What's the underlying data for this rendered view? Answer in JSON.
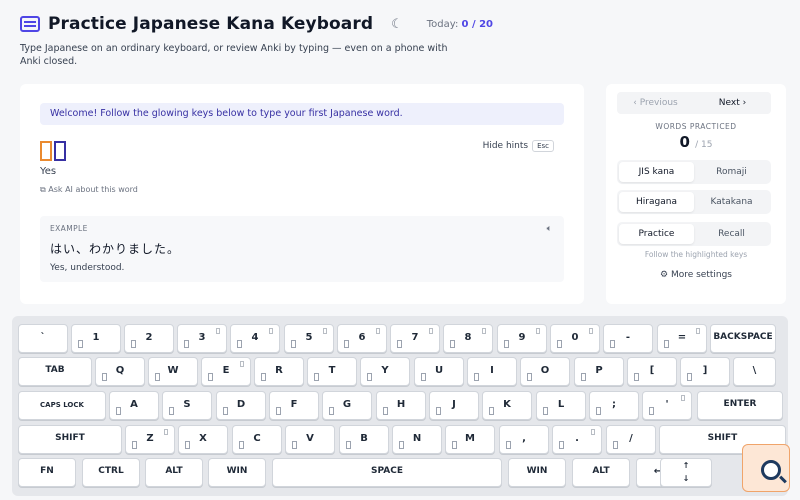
{
  "header": {
    "title": "Practice Japanese Kana Keyboard",
    "today_label": "Today:",
    "today_value": "0 / 20",
    "subtitle": "Type Japanese on an ordinary keyboard, or review Anki by typing — even on a phone with Anki closed."
  },
  "main": {
    "banner": "Welcome! Follow the glowing keys below to type your first Japanese word.",
    "meaning": "Yes",
    "ask_ai": "Ask AI about this word",
    "hide_hints": "Hide hints",
    "esc": "Esc",
    "example_label": "EXAMPLE",
    "example_jp": "はい、わかりました。",
    "example_en": "Yes, understood."
  },
  "side": {
    "prev": "‹  Previous",
    "next": "Next  ›",
    "words_label": "WORDS PRACTICED",
    "words_count": "0",
    "words_total": "/ 15",
    "layout_opts": [
      "JIS kana",
      "Romaji"
    ],
    "script_opts": [
      "Hiragana",
      "Katakana"
    ],
    "mode_opts": [
      "Practice",
      "Recall"
    ],
    "follow": "Follow the highlighted keys",
    "more_settings": "More settings"
  },
  "keyboard": {
    "row1": [
      "`",
      "1",
      "2",
      "3",
      "4",
      "5",
      "6",
      "7",
      "8",
      "9",
      "0",
      "-",
      "=",
      "BACKSPACE"
    ],
    "row2": [
      "TAB",
      "Q",
      "W",
      "E",
      "R",
      "T",
      "Y",
      "U",
      "I",
      "O",
      "P",
      "[",
      "]",
      "\\"
    ],
    "row3": [
      "CAPS LOCK",
      "A",
      "S",
      "D",
      "F",
      "G",
      "H",
      "J",
      "K",
      "L",
      ";",
      "'",
      "ENTER"
    ],
    "row4": [
      "SHIFT",
      "Z",
      "X",
      "C",
      "V",
      "B",
      "N",
      "M",
      ",",
      ".",
      "/",
      "SHIFT"
    ],
    "row5": [
      "FN",
      "CTRL",
      "ALT",
      "WIN",
      "SPACE",
      "WIN",
      "ALT",
      "←",
      "↑",
      "↓"
    ]
  }
}
